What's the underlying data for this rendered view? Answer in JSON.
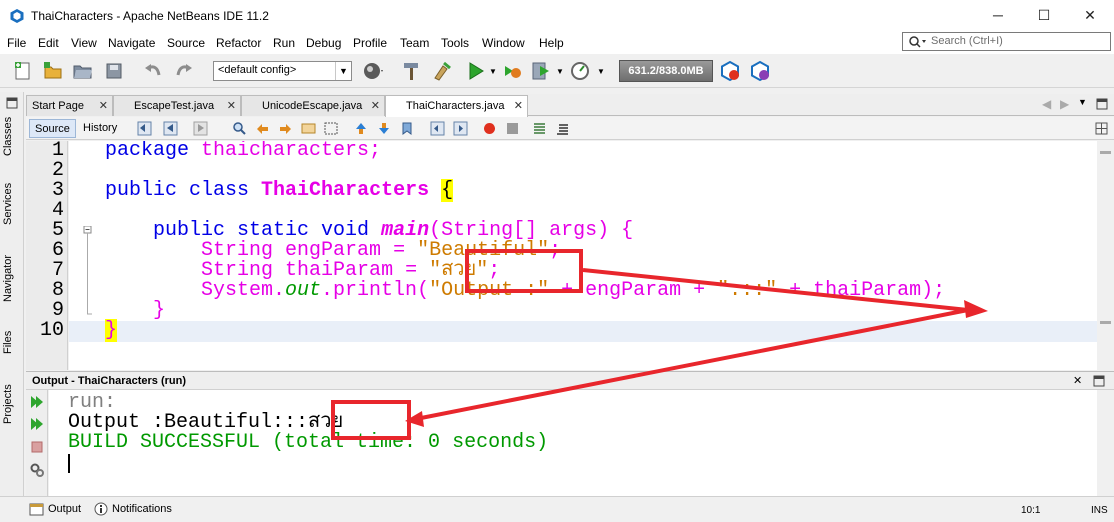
{
  "window": {
    "title": "ThaiCharacters - Apache NetBeans IDE 11.2",
    "minimize": "─",
    "maximize": "☐",
    "close": "✕"
  },
  "menu": [
    "File",
    "Edit",
    "View",
    "Navigate",
    "Source",
    "Refactor",
    "Run",
    "Debug",
    "Profile",
    "Team",
    "Tools",
    "Window",
    "Help"
  ],
  "search": {
    "placeholder": "Search (Ctrl+I)"
  },
  "toolbar": {
    "config": "<default config>",
    "memory": "631.2/838.0MB"
  },
  "side_tabs": [
    "Classes",
    "Services",
    "Navigator",
    "Files",
    "Projects"
  ],
  "editor_tabs": [
    {
      "label": "Start Page"
    },
    {
      "label": "EscapeTest.java"
    },
    {
      "label": "UnicodeEscape.java"
    },
    {
      "label": "ThaiCharacters.java"
    }
  ],
  "editor_modes": {
    "source": "Source",
    "history": "History"
  },
  "code": {
    "line_numbers": [
      "1",
      "2",
      "3",
      "4",
      "5",
      "6",
      "7",
      "8",
      "9",
      "10"
    ],
    "l1_kw": "package",
    "l1_pkg": "thaicharacters;",
    "l3_kw": "public class",
    "l3_cls": "ThaiCharacters",
    "l3_brace": "{",
    "l5_kw": "public static void",
    "l5_mth": "main",
    "l5_rest": "(String[] args) {",
    "l6_type": "String",
    "l6_var": "engParam =",
    "l6_str": "\"Beautiful\"",
    "l6_end": ";",
    "l7_type": "String",
    "l7_var": "thaiParam =",
    "l7_str": "\"สวย\"",
    "l7_end": ";",
    "l8_a": "System.",
    "l8_out": "out",
    "l8_b": ".println(",
    "l8_s1": "\"Output :\"",
    "l8_c": " + engParam + ",
    "l8_s2": "\":::\"",
    "l8_d": " + thaiParam);",
    "l9": "}",
    "l10": "}"
  },
  "output": {
    "title": "Output - ThaiCharacters (run)",
    "line1": "run:",
    "line2_a": "Output :Beautiful:::",
    "line2_b": "สวย",
    "line3": "BUILD SUCCESSFUL (total time: 0 seconds)"
  },
  "status": {
    "output": "Output",
    "notifications": "Notifications",
    "position": "10:1",
    "mode": "INS"
  },
  "colors": {
    "annotation": "#e8262c",
    "keyword": "#0000e6",
    "string": "#ce7b00",
    "identifier": "#e600e6",
    "success": "#009900"
  }
}
